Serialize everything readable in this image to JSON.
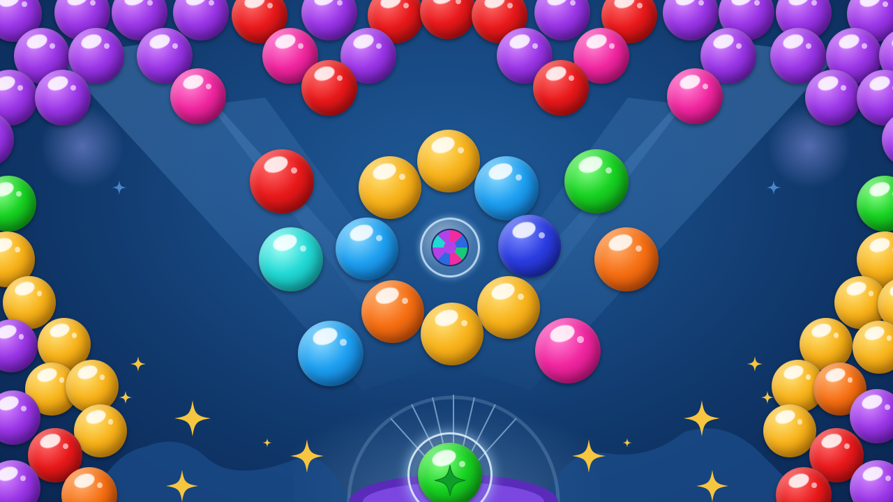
{
  "game": {
    "colors": {
      "red": "#e8191b",
      "purple": "#9a36e6",
      "pink": "#f0269f",
      "yellow": "#f7b21a",
      "orange": "#f56e12",
      "green": "#17d121",
      "blue": "#1e9ff0",
      "navy": "#2b3de0",
      "cyan": "#22d8d4"
    },
    "center_cluster": [
      "red",
      "yellow",
      "blue",
      "green",
      "cyan",
      "blue",
      "multicolor",
      "navy",
      "orange",
      "blue",
      "orange",
      "yellow",
      "yellow",
      "pink"
    ],
    "special_bubble": "rainbow-bubble-icon",
    "shooter_bubble_color": "green",
    "decorations": [
      "sparkle-star-icon"
    ]
  }
}
